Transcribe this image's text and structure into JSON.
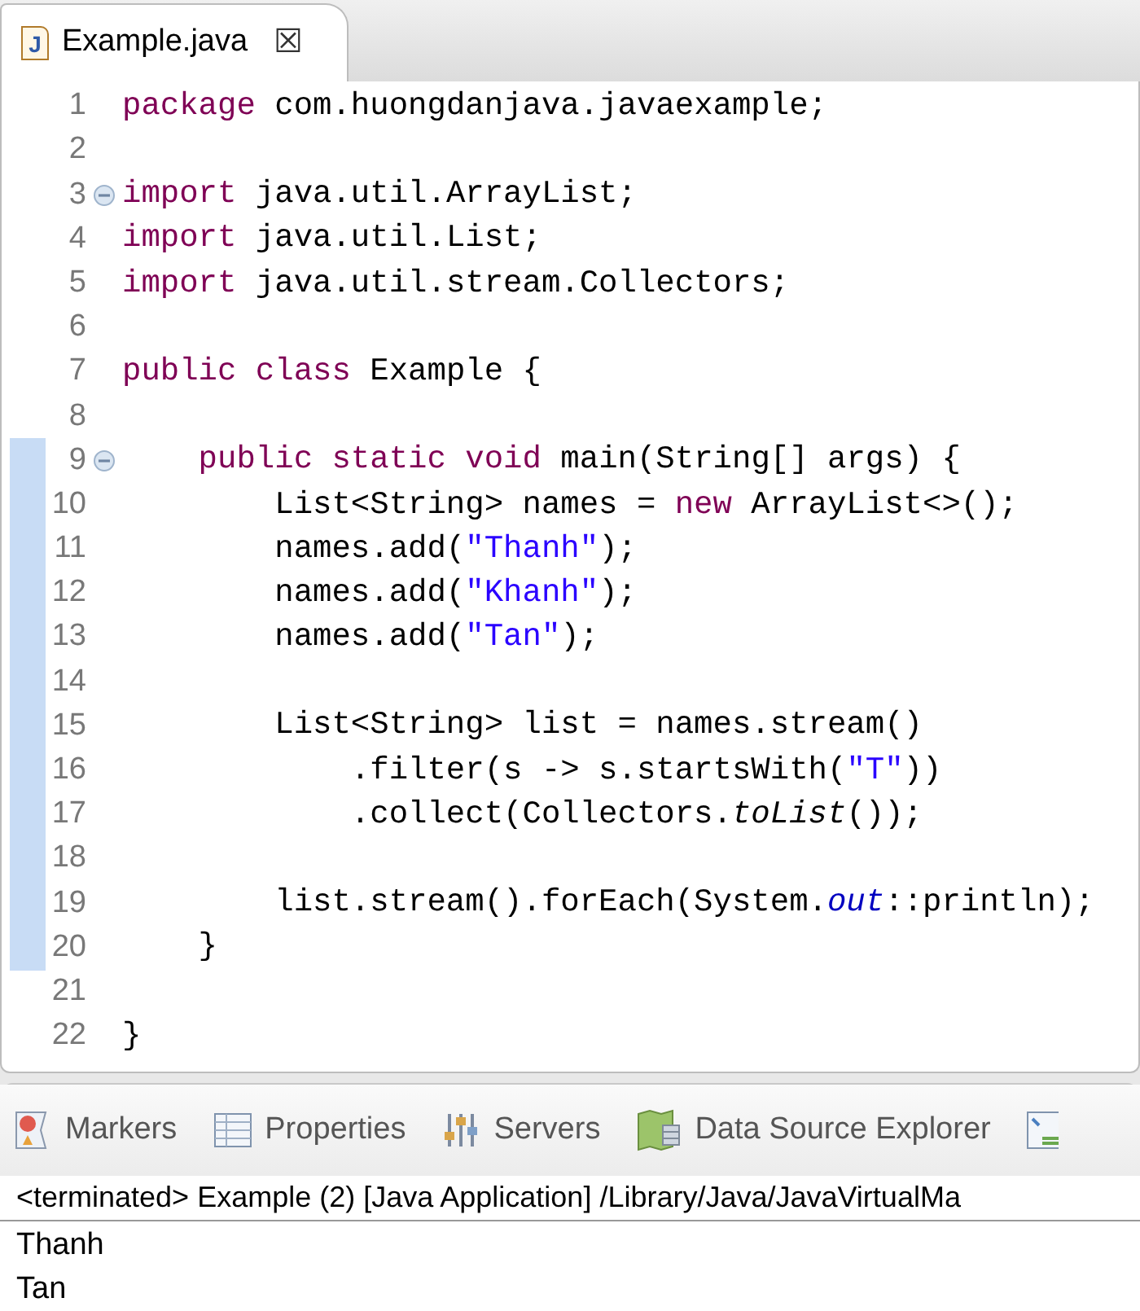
{
  "editor_tab": {
    "icon_letter": "J",
    "title": "Example.java",
    "close": "☒"
  },
  "code_lines": [
    {
      "number": "1",
      "fold": false,
      "range_marked": false,
      "tokens": [
        {
          "kind": "keyword",
          "text": "package"
        },
        {
          "kind": "plain",
          "text": " com.huongdanjava.javaexample;"
        }
      ]
    },
    {
      "number": "2",
      "fold": false,
      "range_marked": false
    },
    {
      "number": "3",
      "fold": true,
      "range_marked": false,
      "tokens": [
        {
          "kind": "keyword",
          "text": "import"
        },
        {
          "kind": "plain",
          "text": " java.util.ArrayList;"
        }
      ]
    },
    {
      "number": "4",
      "fold": false,
      "range_marked": false,
      "tokens": [
        {
          "kind": "keyword",
          "text": "import"
        },
        {
          "kind": "plain",
          "text": " java.util.List;"
        }
      ]
    },
    {
      "number": "5",
      "fold": false,
      "range_marked": false,
      "tokens": [
        {
          "kind": "keyword",
          "text": "import"
        },
        {
          "kind": "plain",
          "text": " java.util.stream.Collectors;"
        }
      ]
    },
    {
      "number": "6",
      "fold": false,
      "range_marked": false
    },
    {
      "number": "7",
      "fold": false,
      "range_marked": false,
      "tokens": [
        {
          "kind": "keyword",
          "text": "public"
        },
        {
          "kind": "keyword",
          "text": " class"
        },
        {
          "kind": "plain",
          "text": " Example {"
        }
      ]
    },
    {
      "number": "8",
      "fold": false,
      "range_marked": false
    },
    {
      "number": "9",
      "fold": true,
      "range_marked": true,
      "tokens": [
        {
          "kind": "keyword",
          "text": "    public"
        },
        {
          "kind": "keyword",
          "text": " static"
        },
        {
          "kind": "keyword",
          "text": " void"
        },
        {
          "kind": "plain",
          "text": " main(String[] args) {"
        }
      ]
    },
    {
      "number": "10",
      "fold": false,
      "range_marked": true,
      "tokens": [
        {
          "kind": "plain",
          "text": "        List<String> names = "
        },
        {
          "kind": "keyword",
          "text": "new"
        },
        {
          "kind": "plain",
          "text": " ArrayList<>();"
        }
      ]
    },
    {
      "number": "11",
      "fold": false,
      "range_marked": true,
      "tokens": [
        {
          "kind": "plain",
          "text": "        names.add("
        },
        {
          "kind": "string",
          "text": "\"Thanh\""
        },
        {
          "kind": "plain",
          "text": ");"
        }
      ]
    },
    {
      "number": "12",
      "fold": false,
      "range_marked": true,
      "tokens": [
        {
          "kind": "plain",
          "text": "        names.add("
        },
        {
          "kind": "string",
          "text": "\"Khanh\""
        },
        {
          "kind": "plain",
          "text": ");"
        }
      ]
    },
    {
      "number": "13",
      "fold": false,
      "range_marked": true,
      "tokens": [
        {
          "kind": "plain",
          "text": "        names.add("
        },
        {
          "kind": "string",
          "text": "\"Tan\""
        },
        {
          "kind": "plain",
          "text": ");"
        }
      ]
    },
    {
      "number": "14",
      "fold": false,
      "range_marked": true
    },
    {
      "number": "15",
      "fold": false,
      "range_marked": true,
      "tokens": [
        {
          "kind": "plain",
          "text": "        List<String> list = names.stream()"
        }
      ]
    },
    {
      "number": "16",
      "fold": false,
      "range_marked": true,
      "tokens": [
        {
          "kind": "plain",
          "text": "            .filter(s -> s.startsWith("
        },
        {
          "kind": "string",
          "text": "\"T\""
        },
        {
          "kind": "plain",
          "text": "))"
        }
      ]
    },
    {
      "number": "17",
      "fold": false,
      "range_marked": true,
      "tokens": [
        {
          "kind": "plain",
          "text": "            .collect(Collectors."
        },
        {
          "kind": "static_method",
          "text": "toList"
        },
        {
          "kind": "plain",
          "text": "());"
        }
      ]
    },
    {
      "number": "18",
      "fold": false,
      "range_marked": true
    },
    {
      "number": "19",
      "fold": false,
      "range_marked": true,
      "tokens": [
        {
          "kind": "plain",
          "text": "        list.stream().forEach(System."
        },
        {
          "kind": "static_field",
          "text": "out"
        },
        {
          "kind": "plain",
          "text": "::println);"
        }
      ]
    },
    {
      "number": "20",
      "fold": false,
      "range_marked": true,
      "tokens": [
        {
          "kind": "plain",
          "text": "    }"
        }
      ]
    },
    {
      "number": "21",
      "fold": false,
      "range_marked": false
    },
    {
      "number": "22",
      "fold": false,
      "range_marked": false,
      "tokens": [
        {
          "kind": "plain",
          "text": "}"
        }
      ]
    }
  ],
  "panel_tabs": [
    {
      "kind": "markers",
      "label": "Markers"
    },
    {
      "kind": "properties",
      "label": "Properties"
    },
    {
      "kind": "servers",
      "label": "Servers"
    },
    {
      "kind": "data_source",
      "label": "Data Source Explorer"
    },
    {
      "kind": "other"
    }
  ],
  "console": {
    "header": "<terminated> Example (2) [Java Application] /Library/Java/JavaVirtualMa",
    "output": [
      "Thanh",
      "Tan"
    ]
  }
}
